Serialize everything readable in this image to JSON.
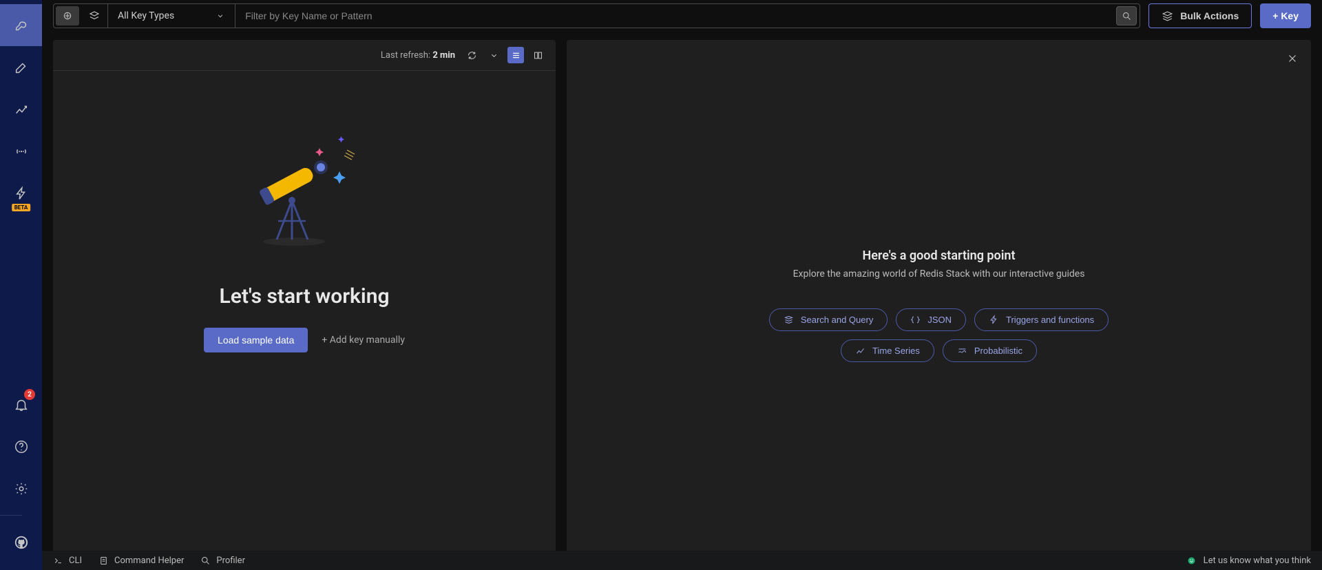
{
  "sidebar": {
    "beta_label": "BETA",
    "notification_count": "2"
  },
  "toolbar": {
    "key_type_label": "All Key Types",
    "filter_placeholder": "Filter by Key Name or Pattern",
    "bulk_label": "Bulk Actions",
    "add_key_label": "+ Key"
  },
  "left_panel": {
    "refresh_label": "Last refresh:",
    "refresh_value": "2 min",
    "empty_title": "Let's start working",
    "load_sample_label": "Load sample data",
    "add_manual_label": "+ Add key manually"
  },
  "right_panel": {
    "title": "Here's a good starting point",
    "subtitle": "Explore the amazing world of Redis Stack with our interactive guides",
    "guides": [
      "Search and Query",
      "JSON",
      "Triggers and functions",
      "Time Series",
      "Probabilistic"
    ]
  },
  "footer": {
    "cli": "CLI",
    "helper": "Command Helper",
    "profiler": "Profiler",
    "feedback": "Let us know what you think"
  }
}
